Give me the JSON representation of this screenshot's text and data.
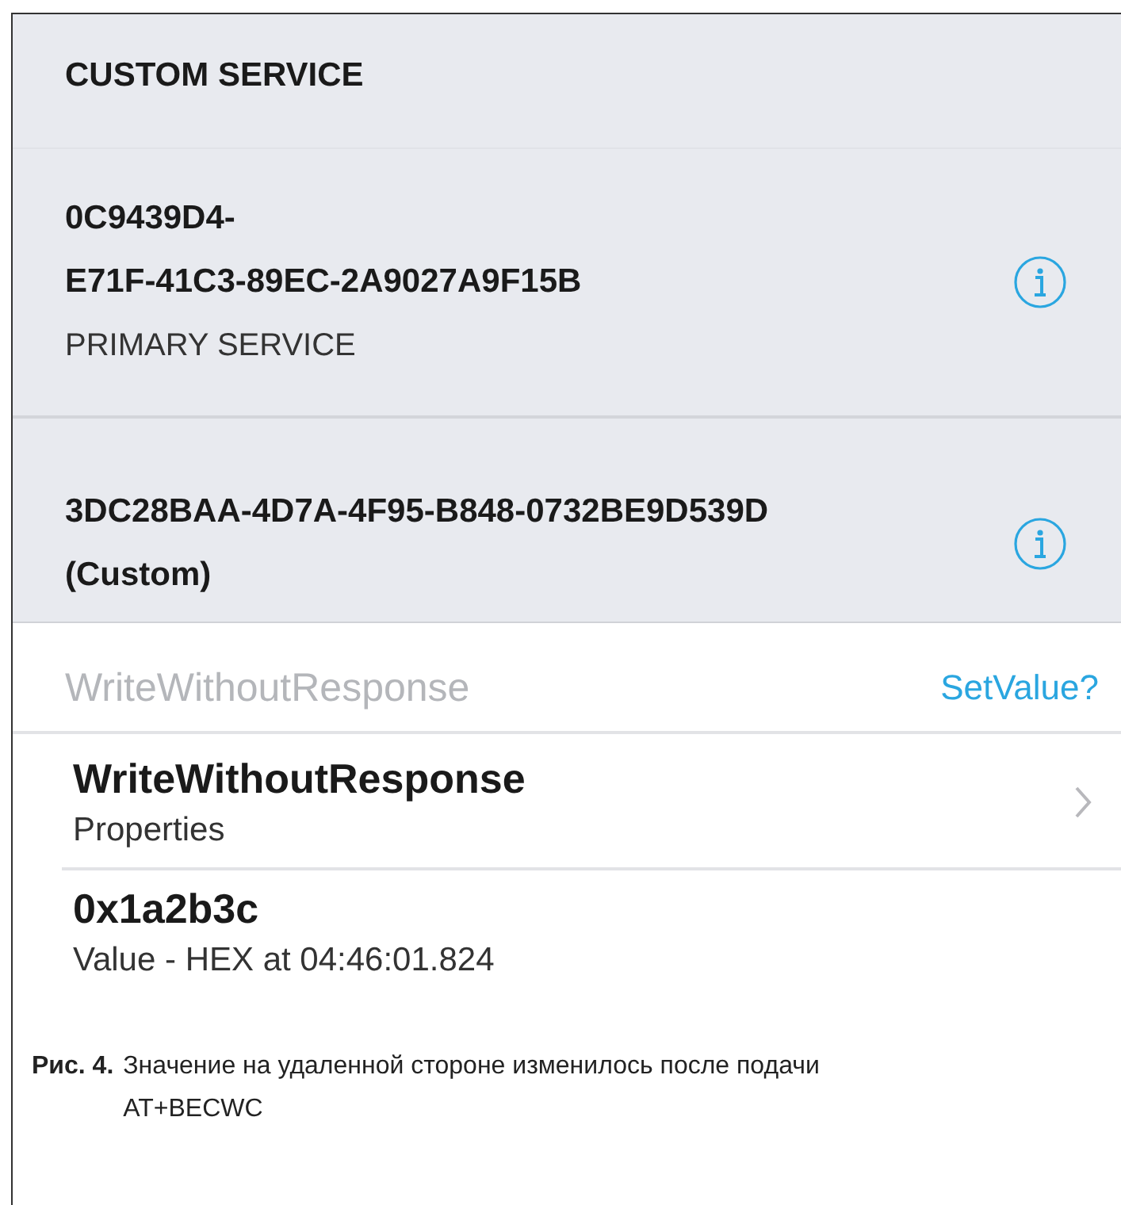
{
  "section_header": "CUSTOM SERVICE",
  "service": {
    "uuid_lines": [
      "0C9439D4-",
      "E71F-41C3-89EC-2A9027A9F15B"
    ],
    "type": "PRIMARY SERVICE"
  },
  "characteristic": {
    "uuid": "3DC28BAA-4D7A-4F95-B848-0732BE9D539D",
    "note": "(Custom)"
  },
  "write_row": {
    "label": "WriteWithoutResponse",
    "disabled": true,
    "action": "SetValue?"
  },
  "properties_row": {
    "title": "WriteWithoutResponse",
    "subtitle": "Properties"
  },
  "value_row": {
    "title": "0x1a2b3c",
    "subtitle": "Value - HEX at 04:46:01.824"
  },
  "caption": {
    "label": "**Рис. 4.**",
    "lines": [
      "Значение на удаленной стороне изменилось после подачи",
      "AT+BECWC"
    ]
  }
}
